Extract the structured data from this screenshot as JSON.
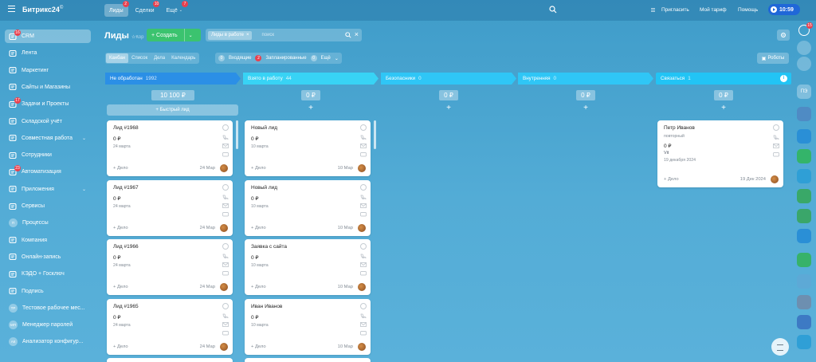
{
  "topbar": {
    "brand": "Битрикс24",
    "brand_mark": "©",
    "tabs": [
      {
        "label": "Лиды",
        "badge": "2",
        "active": true
      },
      {
        "label": "Сделки",
        "badge": "10",
        "active": false
      },
      {
        "label": "Ещё",
        "badge": "7",
        "active": false
      }
    ],
    "invite": "Пригласить",
    "tariff": "Мой тариф",
    "help": "Помощь",
    "time": "10:59"
  },
  "sidebar": {
    "items": [
      {
        "label": "CRM",
        "icon": "crm-icon",
        "badge": "16",
        "active": true
      },
      {
        "label": "Лента",
        "icon": "feed-icon"
      },
      {
        "label": "Маркетинг",
        "icon": "marketing-icon"
      },
      {
        "label": "Сайты и Магазины",
        "icon": "cart-icon"
      },
      {
        "label": "Задачи и Проекты",
        "icon": "tasks-icon",
        "badge": "17"
      },
      {
        "label": "Складской учёт",
        "icon": "warehouse-icon"
      },
      {
        "label": "Совместная работа",
        "icon": "collab-icon",
        "chevron": true
      },
      {
        "label": "Сотрудники",
        "icon": "employees-icon"
      },
      {
        "label": "Автоматизация",
        "icon": "automation-icon",
        "badge": "23"
      },
      {
        "label": "Приложения",
        "icon": "apps-icon",
        "chevron": true
      },
      {
        "label": "Сервисы",
        "icon": "services-icon"
      },
      {
        "label": "Процессы",
        "icon": "processes-icon",
        "round": "П"
      },
      {
        "label": "Компания",
        "icon": "company-icon"
      },
      {
        "label": "Онлайн-запись",
        "icon": "booking-icon"
      },
      {
        "label": "КЭДО + Госключ",
        "icon": "kedo-icon"
      },
      {
        "label": "Подпись",
        "icon": "sign-icon"
      },
      {
        "label": "Тестовое рабочее мес...",
        "icon": "workspace-icon",
        "round": "ТР"
      },
      {
        "label": "Менеджер паролей",
        "icon": "password-icon",
        "round": "МП"
      },
      {
        "label": "Анализатор конфигур...",
        "icon": "analyzer-icon",
        "round": "АК"
      }
    ]
  },
  "header": {
    "title": "Лиды",
    "title_star": "☆",
    "title_cut": "Кор",
    "create": "Создать",
    "filter_chip": "Лиды в работе",
    "search_placeholder": "поиск",
    "view_tabs": [
      "Канбан",
      "Список",
      "Дела",
      "Календарь"
    ],
    "activity_filters": [
      {
        "label": "Входящие",
        "count": "0"
      },
      {
        "label": "Запланированные",
        "count": "2"
      },
      {
        "label": "Ещё",
        "count": "0"
      }
    ],
    "robots": "Роботы"
  },
  "kanban": {
    "columns": [
      {
        "name": "Не обработан",
        "count": "1992",
        "color": "#2b8fe6",
        "sum": "10 100 ₽"
      },
      {
        "name": "Взято в работу",
        "count": "44",
        "color": "#38d3f5",
        "sum": "0 ₽"
      },
      {
        "name": "Безопасники",
        "count": "0",
        "color": "#2fc6f6",
        "sum": "0 ₽"
      },
      {
        "name": "Внутренняя",
        "count": "0",
        "color": "#2fc6f6",
        "sum": "0 ₽"
      },
      {
        "name": "Связаться",
        "count": "1",
        "color": "#22c4f5",
        "sum": "0 ₽"
      }
    ],
    "quick_lead": "Быстрый лид",
    "add_symbol": "+",
    "col1_cards": [
      {
        "title": "Лид #1968",
        "amount": "0 ₽",
        "date": "24 марта",
        "deal": "+ Дело",
        "cdate": "24 Мар"
      },
      {
        "title": "Лид #1967",
        "amount": "0 ₽",
        "date": "24 марта",
        "deal": "+ Дело",
        "cdate": "24 Мар"
      },
      {
        "title": "Лид #1966",
        "amount": "0 ₽",
        "date": "24 марта",
        "deal": "+ Дело",
        "cdate": "24 Мар"
      },
      {
        "title": "Лид #1965",
        "amount": "0 ₽",
        "date": "24 марта",
        "deal": "+ Дело",
        "cdate": "24 Мар"
      }
    ],
    "col2_cards": [
      {
        "title": "Новый лид",
        "amount": "0 ₽",
        "date": "10 марта",
        "deal": "+ Дело",
        "cdate": "10 Мар"
      },
      {
        "title": "Новый лид",
        "amount": "0 ₽",
        "date": "10 марта",
        "deal": "+ Дело",
        "cdate": "10 Мар"
      },
      {
        "title": "Заявка с сайта",
        "amount": "0 ₽",
        "date": "10 марта",
        "deal": "+ Дело",
        "cdate": "10 Мар"
      },
      {
        "title": "Иван Иванов",
        "amount": "0 ₽",
        "date": "10 марта",
        "deal": "+ Дело",
        "cdate": "10 Мар"
      }
    ],
    "col5_card": {
      "title": "Петр Иванов",
      "subtitle": "повторный",
      "amount": "0 ₽",
      "extra": "Vit",
      "date": "19 декабря 2024",
      "deal": "+ Дело",
      "cdate": "19 Дек 2024"
    }
  },
  "rail": {
    "notif_badge": "15",
    "avatar_text": "ПЭ"
  }
}
